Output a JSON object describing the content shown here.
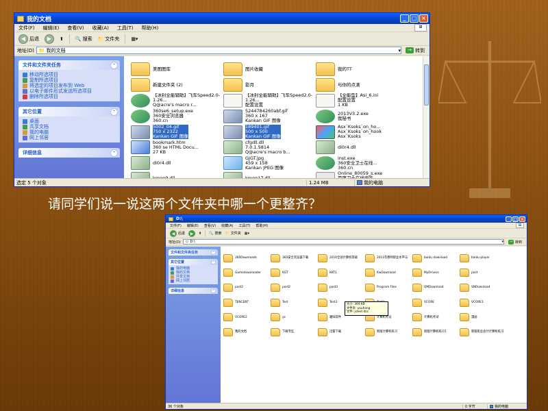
{
  "question": "请同学们说一说这两个文件夹中哪一个更整齐？",
  "window1": {
    "title": "我的文档",
    "menu": [
      "文件(F)",
      "编辑(E)",
      "查看(V)",
      "收藏(A)",
      "工具(T)",
      "帮助(H)"
    ],
    "toolbar": {
      "back": "后退",
      "search": "搜索",
      "folders": "文件夹"
    },
    "address_label": "地址(D)",
    "address_value": "我的文档",
    "go_label": "转到",
    "panels": [
      {
        "title": "文件和文件夹任务",
        "links": [
          "移动所选项目",
          "复制所选项目",
          "将选定的项目发布到 Web",
          "以电子邮件形式发送所选项目",
          "删除所选项目"
        ]
      },
      {
        "title": "其它位置",
        "links": [
          "桌面",
          "共享文档",
          "我的电脑",
          "网上邻居"
        ]
      },
      {
        "title": "详细信息",
        "links": []
      }
    ],
    "files": [
      {
        "type": "folder",
        "name": "美图图库",
        "selected": false
      },
      {
        "type": "folder",
        "name": "图片收藏",
        "selected": false
      },
      {
        "type": "folder",
        "name": "我的TT",
        "selected": false
      },
      {
        "type": "folder",
        "name": "新建文件夹 (2)",
        "selected": false
      },
      {
        "type": "folder",
        "name": "影月",
        "selected": false
      },
      {
        "type": "folder",
        "name": "与你的点滴",
        "selected": false
      },
      {
        "type": "exe",
        "name": "【冰封全能辅助】飞车Speed2.0-1.26...\nQ@acre's macro r...",
        "selected": false
      },
      {
        "type": "ini",
        "name": "【冰封全能辅助】飞车Speed2.0-1.26...\n配置设置",
        "selected": false
      },
      {
        "type": "ini",
        "name": "【全能型】Asi_6.ini\n配置设置\n1 KB",
        "selected": false
      },
      {
        "type": "exe",
        "name": "360se6_setup.exe\n360安全浏览器\n360.cn",
        "selected": false
      },
      {
        "type": "gif",
        "name": "5244784260abf.gif\n360 x 167\nKankan GIF 图像",
        "selected": false
      },
      {
        "type": "exe",
        "name": "2013V3.2.exe\n我秘书\n",
        "selected": false
      },
      {
        "type": "gif",
        "name": "5002_04.gif\n750 x 2322\nKankan GIF 图像",
        "selected": true
      },
      {
        "type": "gif",
        "name": "189401.gif\n500 x 500\nKankan GIF 图像",
        "selected": true
      },
      {
        "type": "png",
        "name": "Asx`Ksoks`on_ho...\nAsx`Ksoks`on_hook\nAsx`Ksoks",
        "selected": false
      },
      {
        "type": "htm",
        "name": "bookmark.htm\n360 se HTML Docu...\n27 KB",
        "selected": false
      },
      {
        "type": "dll",
        "name": "cfgdll.dll\n7.0.1.5814\nQ@acre's macro b...",
        "selected": false
      },
      {
        "type": "dll",
        "name": "di0r4.dll",
        "selected": false
      },
      {
        "type": "dll",
        "name": "di0r4.dll",
        "selected": false
      },
      {
        "type": "jpg",
        "name": "GJGT.jpg\n459 x 158\nKankan JPEG 图像",
        "selected": false
      },
      {
        "type": "exe",
        "name": "inst.exe\n360安全卫士在线...\n360.cn",
        "selected": false
      },
      {
        "type": "dll",
        "name": "kmop9.dll",
        "selected": false
      },
      {
        "type": "dll",
        "name": "kmop17.dll",
        "selected": false
      },
      {
        "type": "ttf",
        "name": "Online_80059_s.exe\n百度卫士在线安装\n百度在线网络技术...",
        "selected": false
      }
    ],
    "status_left": "选定 5 个对象",
    "status_size": "1.24 MB",
    "status_location": "我的电脑"
  },
  "window2": {
    "title": "D:\\",
    "menu": [
      "文件(F)",
      "编辑(E)",
      "查看(V)",
      "收藏(A)",
      "工具(T)",
      "帮助(H)"
    ],
    "toolbar": {
      "back": "后退",
      "search": "搜索",
      "folders": "文件夹"
    },
    "address_label": "地址(D)",
    "address_value": "D:\\",
    "go_label": "转到",
    "panels": [
      {
        "title": "文件和文件夹任务",
        "links": []
      },
      {
        "title": "其它位置",
        "links": [
          "我的电脑",
          "我的文档",
          "共享文档",
          "网上邻居"
        ]
      },
      {
        "title": "详细信息",
        "links": []
      }
    ],
    "folders": [
      "360Downloads",
      "360安全浏览器下载",
      "2010全国计算机等级",
      "2011年教师职业水平与",
      "baidu download",
      "baidu player",
      "Gamedownloader",
      "KGT",
      "KKT1",
      "KwDownload",
      "MyDrivers",
      "post",
      "post2",
      "post2",
      "post3",
      "Program Files",
      "QMDownload",
      "SNDownload",
      "TENCENT",
      "Test",
      "Test3",
      "Test2",
      "VCORE",
      "VCORE1",
      "VCORE2",
      "yz",
      "趣味软件",
      "计算机考证",
      "计算机考试",
      "漫画",
      "我的文档",
      "下载专区",
      "迅雷下载",
      "新版计算机练习",
      "新版计算机练习1",
      "新版职业会计计算机练习"
    ],
    "tooltip": {
      "line1": "大小: 369 KB",
      "line2": "文件夹: youhang",
      "line3": "文件: jstest.doc"
    },
    "status_left": "36 个对象",
    "status_size": "0 字节",
    "status_location": "我的电脑"
  }
}
